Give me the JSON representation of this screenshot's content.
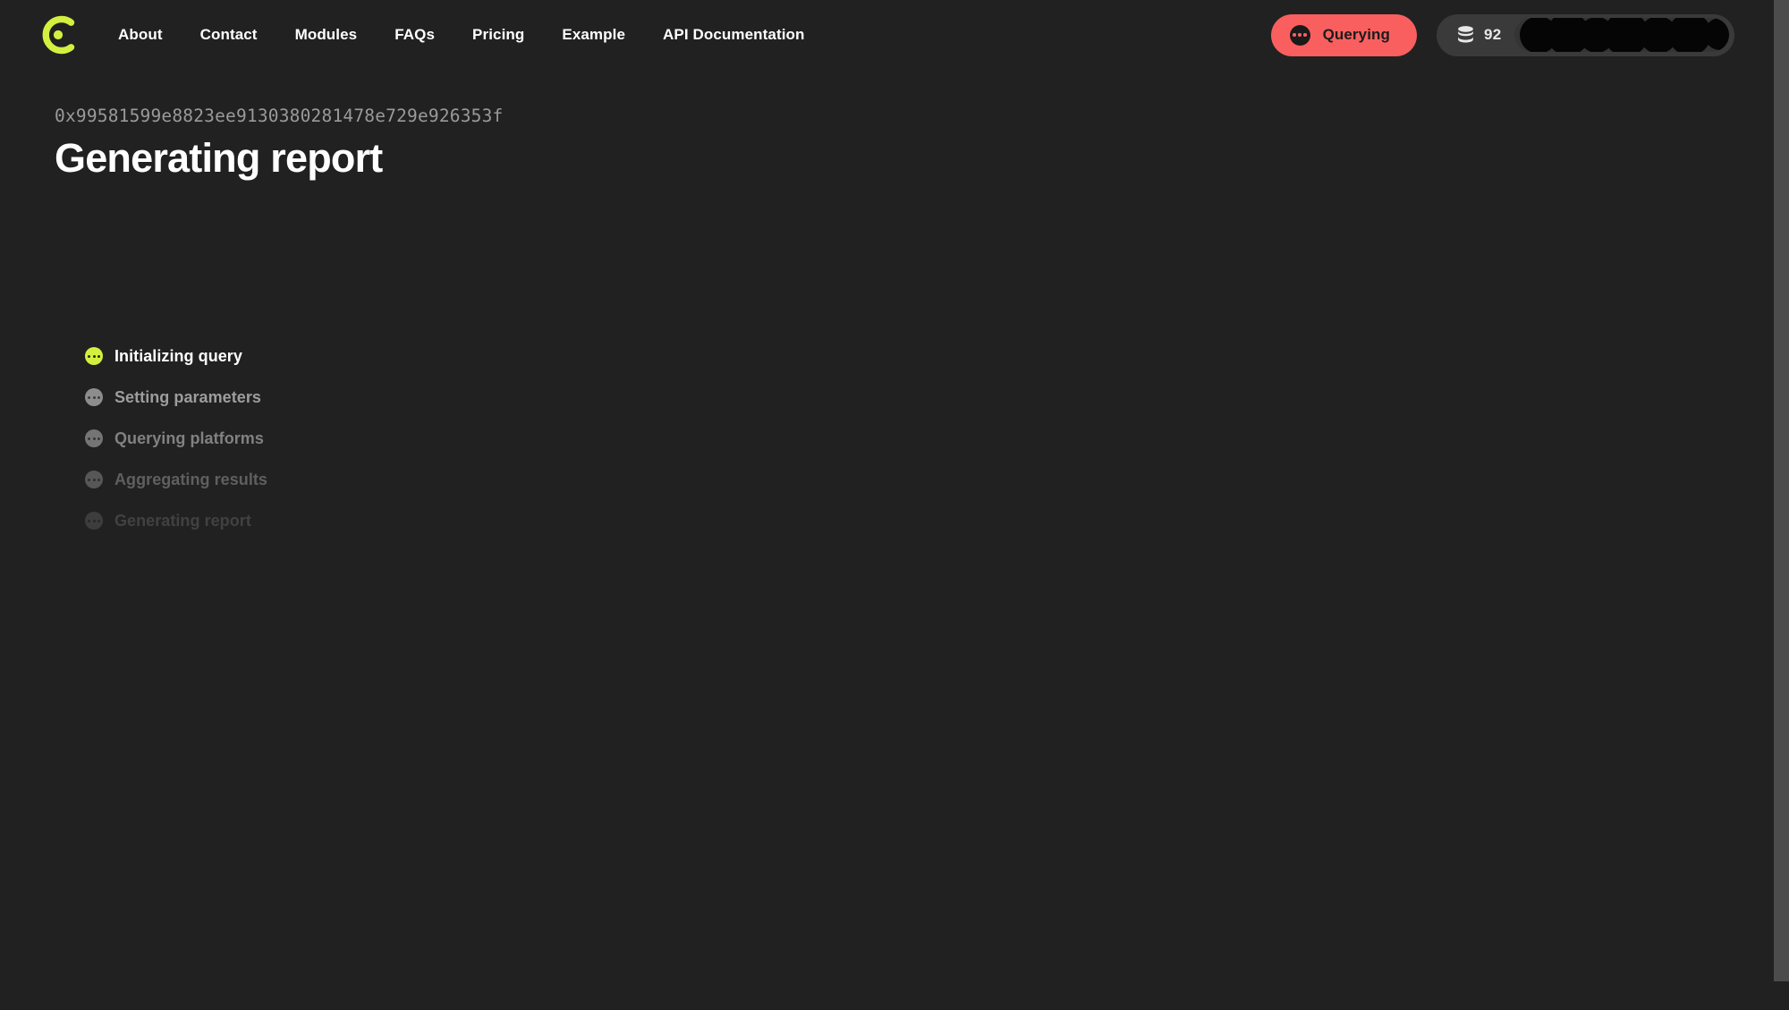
{
  "header": {
    "logo": {
      "icon": "brand-c-logo",
      "color": "#D4F03F"
    },
    "nav": [
      {
        "label": "About"
      },
      {
        "label": "Contact"
      },
      {
        "label": "Modules"
      },
      {
        "label": "FAQs"
      },
      {
        "label": "Pricing"
      },
      {
        "label": "Example"
      },
      {
        "label": "API Documentation"
      }
    ],
    "status": {
      "label": "Querying",
      "icon": "three-dots-circle-icon",
      "bg_color": "#FA5F5F",
      "text_color": "#1B1B1B"
    },
    "account": {
      "credits_icon": "database-stack-icon",
      "credits": "92",
      "wallet_chip_redacted": true
    }
  },
  "main": {
    "wallet_address": "0x99581599e8823ee9130380281478e729e926353f",
    "title": "Generating report",
    "steps": [
      {
        "label": "Initializing query",
        "state": "active",
        "icon": "three-dots-circle-icon"
      },
      {
        "label": "Setting parameters",
        "state": "pending",
        "icon": "three-dots-circle-icon"
      },
      {
        "label": "Querying platforms",
        "state": "pending",
        "icon": "three-dots-circle-icon"
      },
      {
        "label": "Aggregating results",
        "state": "pending",
        "icon": "three-dots-circle-icon"
      },
      {
        "label": "Generating report",
        "state": "pending",
        "icon": "three-dots-circle-icon"
      }
    ]
  },
  "theme": {
    "background": "#212121",
    "accent": "#D4F03F",
    "status_red": "#FA5F5F",
    "text_primary": "#FFFFFF",
    "text_muted": "#9A9A9A"
  }
}
